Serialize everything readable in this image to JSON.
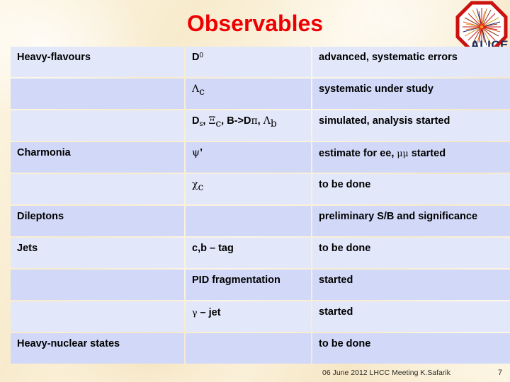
{
  "slide": {
    "title": "Observables",
    "title_color": "#ee0000",
    "background_color": "#fbf1d6"
  },
  "logo": {
    "name": "alice-experiment-logo",
    "wordmark": "ALICE",
    "ring_color": "#cc1111",
    "burst_colors": [
      "#cc1111",
      "#e06020",
      "#d8a030",
      "#8b3a1a",
      "#2a2a6a"
    ]
  },
  "table": {
    "row_shade_light": "#e2e8fa",
    "row_shade_dark": "#d2d9f8",
    "rows": [
      {
        "shade": "light",
        "topic": "Heavy-flavours",
        "channel_html": "D<sup>0</sup>",
        "channel_text": "D0",
        "status": "advanced, systematic errors"
      },
      {
        "shade": "dark",
        "topic": "",
        "channel_html": "<span class=\"gk\">Λ</span><sub class=\"gk\">c</sub>",
        "channel_text": "Λc",
        "status": "systematic under study"
      },
      {
        "shade": "light",
        "topic": "",
        "channel_html": "D<sub>s</sub>, <span class=\"gk\">Ξ</span><sub class=\"gk\">c</sub>, B-&gt;D<span class=\"gk\">π</span>, <span class=\"gk\">Λ</span><sub class=\"gk\">b</sub>",
        "channel_text": "Ds, Ξc, B->Dπ, Λb",
        "status": "simulated, analysis started"
      },
      {
        "shade": "dark",
        "topic": "Charmonia",
        "channel_html": "<span class=\"gk\">ψ</span>’",
        "channel_text": "ψ’",
        "status_html": "estimate for ee, <span class=\"gk-sm\">μμ</span> started",
        "status": "estimate for ee, μμ started"
      },
      {
        "shade": "light",
        "topic": "",
        "channel_html": "<span class=\"gk\">χ</span><sub class=\"gk\">c</sub>",
        "channel_text": "χc",
        "status": "to be done"
      },
      {
        "shade": "dark",
        "topic": "Dileptons",
        "channel_html": "",
        "channel_text": "",
        "status": "preliminary S/B and significance"
      },
      {
        "shade": "light",
        "topic": "Jets",
        "channel_html": "c,b – tag",
        "channel_text": "c,b – tag",
        "status": "to be done"
      },
      {
        "shade": "dark",
        "topic": "",
        "channel_html": "PID fragmentation",
        "channel_text": "PID fragmentation",
        "status": "started"
      },
      {
        "shade": "light",
        "topic": "",
        "channel_html": "<span class=\"gk-sm\">γ</span> – jet",
        "channel_text": "γ – jet",
        "status": "started"
      },
      {
        "shade": "dark",
        "topic": "Heavy-nuclear states",
        "channel_html": "",
        "channel_text": "",
        "status": "to be done"
      }
    ]
  },
  "footer": {
    "text": "06 June 2012 LHCC Meeting K.Safarik",
    "page_number": "7"
  }
}
